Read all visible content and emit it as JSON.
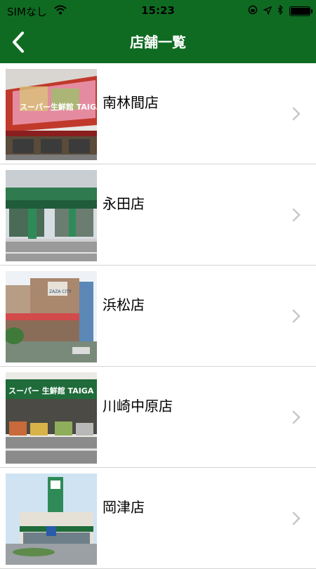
{
  "status_bar": {
    "carrier": "SIMなし",
    "time": "15:23",
    "battery_level": 0.95
  },
  "nav": {
    "title": "店舗一覧"
  },
  "stores": [
    {
      "name": "南林間店",
      "sign": "スーパー生鮮館 TAIGA"
    },
    {
      "name": "永田店"
    },
    {
      "name": "浜松店",
      "sign": "ZAZA CITY"
    },
    {
      "name": "川崎中原店",
      "sign": "スーパー 生鮮館 TAIGA"
    },
    {
      "name": "岡津店"
    }
  ],
  "colors": {
    "brand_green": "#0f6b22",
    "separator": "#d4d4d4",
    "chevron": "#c7c7cc"
  }
}
